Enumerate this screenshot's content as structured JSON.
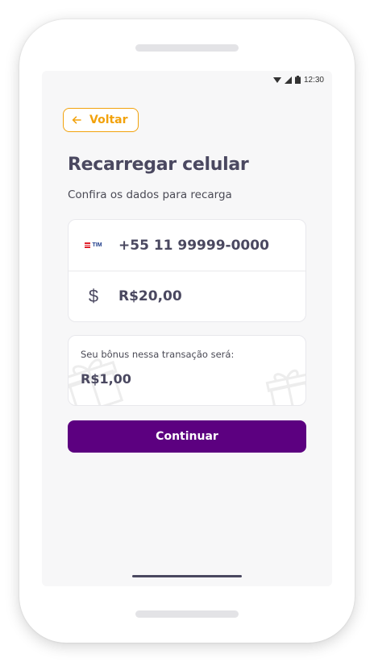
{
  "status_bar": {
    "time": "12:30"
  },
  "header": {
    "back_label": "Voltar"
  },
  "page": {
    "title": "Recarregar celular",
    "subtitle": "Confira os dados para recarga"
  },
  "summary": {
    "operator": "TIM",
    "phone": "+55 11 99999-0000",
    "currency_icon": "$",
    "amount": "R$20,00"
  },
  "bonus": {
    "label": "Seu bônus nessa transação será:",
    "amount": "R$1,00"
  },
  "actions": {
    "continue_label": "Continuar"
  },
  "colors": {
    "accent": "#f2a20c",
    "primary": "#5c0080",
    "text": "#4a4860"
  }
}
